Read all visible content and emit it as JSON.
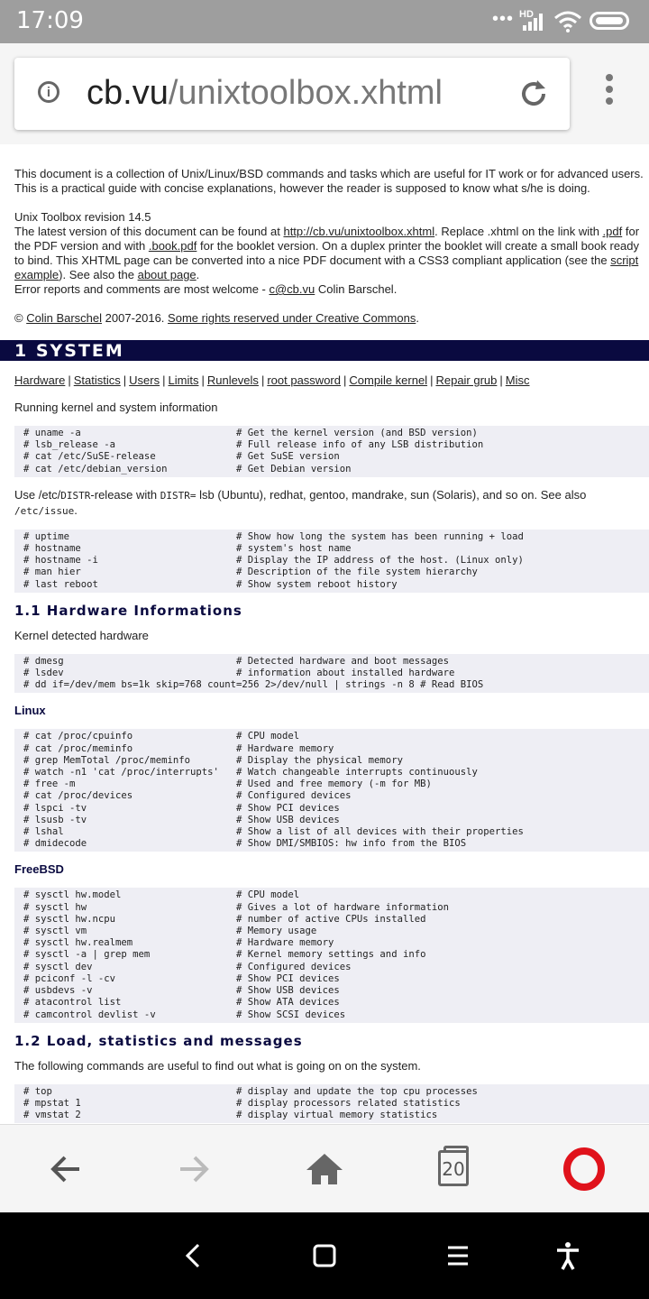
{
  "status_bar": {
    "time": "17:09",
    "hd": "HD"
  },
  "browser": {
    "url_domain": "cb.vu",
    "url_path": "/unixtoolbox.xhtml",
    "tab_count": "20"
  },
  "intro": {
    "p1": "This document is a collection of Unix/Linux/BSD commands and tasks which are useful for IT work or for advanced users. This is a practical guide with concise explanations, however the reader is supposed to know what s/he is doing.",
    "revision": "Unix Toolbox revision 14.5",
    "latest_prefix": "The latest version of this document can be found at ",
    "latest_link": "http://cb.vu/unixtoolbox.xhtml",
    "latest_mid1": ". Replace .xhtml on the link with ",
    "pdf_link": ".pdf",
    "latest_mid2": " for the PDF version and with ",
    "book_link": ".book.pdf",
    "latest_mid3": " for the booklet version. On a duplex printer the booklet will create a small book ready to bind. This XHTML page can be converted into a nice PDF document with a CSS3 compliant application (see the ",
    "script_link": "script example",
    "latest_mid4": "). See also the ",
    "about_link": "about page",
    "latest_end": ".",
    "errors_prefix": "Error reports and comments are most welcome - ",
    "email_link": "c@cb.vu",
    "errors_end": " Colin Barschel.",
    "copyright_prefix": "© ",
    "author_link": "Colin Barschel",
    "copyright_mid": " 2007-2016. ",
    "rights_link": "Some rights reserved under Creative Commons",
    "copyright_end": "."
  },
  "section1": {
    "title": "1 SYSTEM",
    "nav": [
      "Hardware",
      "Statistics",
      "Users",
      "Limits",
      "Runlevels",
      "root password",
      "Compile kernel",
      "Repair grub",
      "Misc"
    ],
    "lead": "Running kernel and system information",
    "code1": "# uname -a                           # Get the kernel version (and BSD version)\n# lsb_release -a                     # Full release info of any LSB distribution\n# cat /etc/SuSE-release              # Get SuSE version\n# cat /etc/debian_version            # Get Debian version",
    "distr_a": "Use /etc/",
    "distr_code1": "DISTR",
    "distr_b": "-release with ",
    "distr_code2": "DISTR=",
    "distr_c": " lsb (Ubuntu), redhat, gentoo, mandrake, sun (Solaris), and so on. See also ",
    "distr_code3": "/etc/issue",
    "distr_d": ".",
    "code2": "# uptime                             # Show how long the system has been running + load\n# hostname                           # system's host name\n# hostname -i                        # Display the IP address of the host. (Linux only)\n# man hier                           # Description of the file system hierarchy\n# last reboot                        # Show system reboot history"
  },
  "section11": {
    "title": "1.1 Hardware Informations",
    "lead": "Kernel detected hardware",
    "code1": "# dmesg                              # Detected hardware and boot messages\n# lsdev                              # information about installed hardware\n# dd if=/dev/mem bs=1k skip=768 count=256 2>/dev/null | strings -n 8 # Read BIOS",
    "linux_title": "Linux",
    "linux_code": "# cat /proc/cpuinfo                  # CPU model\n# cat /proc/meminfo                  # Hardware memory\n# grep MemTotal /proc/meminfo        # Display the physical memory\n# watch -n1 'cat /proc/interrupts'   # Watch changeable interrupts continuously\n# free -m                            # Used and free memory (-m for MB)\n# cat /proc/devices                  # Configured devices\n# lspci -tv                          # Show PCI devices\n# lsusb -tv                          # Show USB devices\n# lshal                              # Show a list of all devices with their properties\n# dmidecode                          # Show DMI/SMBIOS: hw info from the BIOS",
    "freebsd_title": "FreeBSD",
    "freebsd_code": "# sysctl hw.model                    # CPU model\n# sysctl hw                          # Gives a lot of hardware information\n# sysctl hw.ncpu                     # number of active CPUs installed\n# sysctl vm                          # Memory usage\n# sysctl hw.realmem                  # Hardware memory\n# sysctl -a | grep mem               # Kernel memory settings and info\n# sysctl dev                         # Configured devices\n# pciconf -l -cv                     # Show PCI devices\n# usbdevs -v                         # Show USB devices\n# atacontrol list                    # Show ATA devices\n# camcontrol devlist -v              # Show SCSI devices"
  },
  "section12": {
    "title": "1.2 Load, statistics and messages",
    "lead": "The following commands are useful to find out what is going on on the system.",
    "code1": "# top                                # display and update the top cpu processes\n# mpstat 1                           # display processors related statistics\n# vmstat 2                           # display virtual memory statistics"
  },
  "icons": {
    "info": "info-icon",
    "reload": "reload-icon",
    "menu": "overflow-menu-icon",
    "back": "back-arrow-icon",
    "forward": "forward-arrow-icon",
    "home": "home-icon",
    "tabs": "tabs-icon",
    "opera": "opera-logo-icon"
  }
}
